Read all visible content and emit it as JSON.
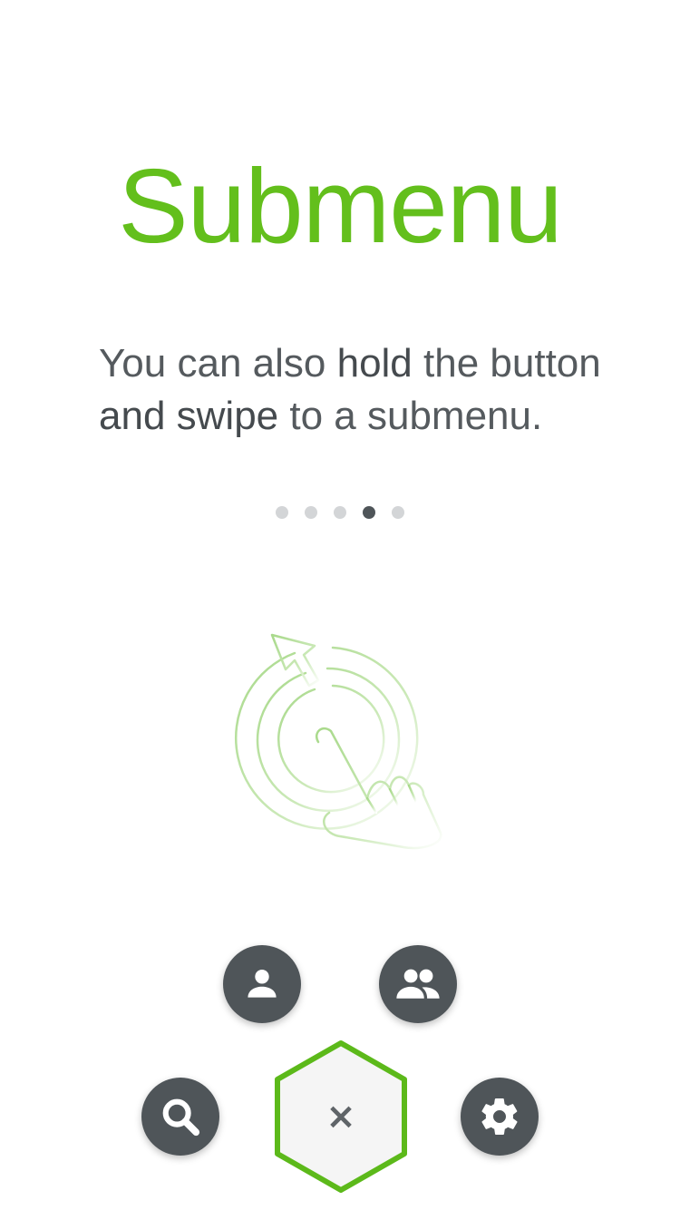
{
  "onboarding": {
    "title": "Submenu",
    "body": {
      "part1": "You can also ",
      "bold1": "hold",
      "part2": " the button ",
      "bold2": "and swipe",
      "part3": " to a submenu."
    },
    "pagination": {
      "total": 5,
      "active_index": 3
    }
  },
  "menu": {
    "close_symbol": "×",
    "items": [
      {
        "id": "profile",
        "icon": "person-icon"
      },
      {
        "id": "groups",
        "icon": "people-icon"
      },
      {
        "id": "search",
        "icon": "search-icon"
      },
      {
        "id": "settings",
        "icon": "gear-icon"
      }
    ]
  },
  "colors": {
    "accent": "#63bf1c",
    "button": "#4f5559",
    "text": "#555a5e",
    "dot_inactive": "#d3d5d7",
    "dot_active": "#4f5559"
  }
}
